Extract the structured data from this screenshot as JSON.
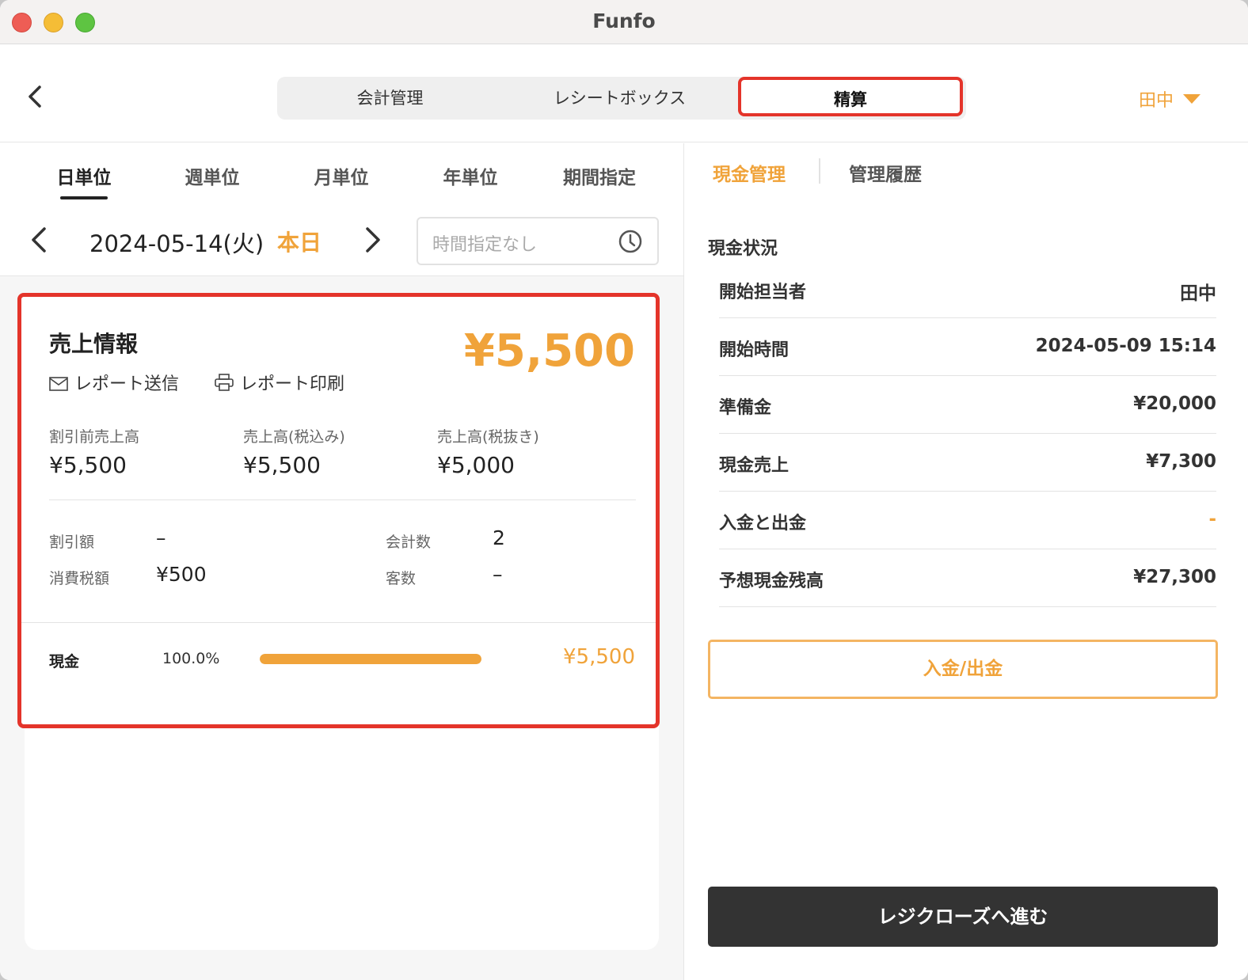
{
  "window": {
    "title": "Funfo"
  },
  "header": {
    "tabs": [
      {
        "label": "会計管理"
      },
      {
        "label": "レシートボックス"
      },
      {
        "label": "精算"
      }
    ],
    "user": "田中"
  },
  "left": {
    "period_tabs": [
      {
        "label": "日単位"
      },
      {
        "label": "週単位"
      },
      {
        "label": "月単位"
      },
      {
        "label": "年単位"
      },
      {
        "label": "期間指定"
      }
    ],
    "date": "2024-05-14(火)",
    "today": "本日",
    "time_placeholder": "時間指定なし",
    "sales": {
      "title": "売上情報",
      "total": "¥5,500",
      "report_send": "レポート送信",
      "report_print": "レポート印刷",
      "stats": [
        {
          "label": "割引前売上高",
          "value": "¥5,500"
        },
        {
          "label": "売上高(税込み)",
          "value": "¥5,500"
        },
        {
          "label": "売上高(税抜き)",
          "value": "¥5,000"
        }
      ],
      "discount_label": "割引額",
      "discount_value": "–",
      "tax_label": "消費税額",
      "tax_value": "¥500",
      "count_label": "会計数",
      "count_value": "2",
      "guests_label": "客数",
      "guests_value": "–",
      "payment": {
        "label": "現金",
        "percent": "100.0%",
        "fraction": 1.0,
        "amount": "¥5,500"
      }
    }
  },
  "right": {
    "tabs": [
      {
        "label": "現金管理"
      },
      {
        "label": "管理履歴"
      }
    ],
    "section_title": "現金状況",
    "rows": [
      {
        "label": "開始担当者",
        "value": "田中"
      },
      {
        "label": "開始時間",
        "value": "2024-05-09 15:14"
      },
      {
        "label": "準備金",
        "value": "¥20,000"
      },
      {
        "label": "現金売上",
        "value": "¥7,300"
      },
      {
        "label": "入金と出金",
        "value": "-"
      },
      {
        "label": "予想現金残高",
        "value": "¥27,300"
      }
    ],
    "deposit_button": "入金/出金",
    "close_button": "レジクローズへ進む"
  },
  "colors": {
    "accent": "#f0a33a",
    "highlight": "#e4342a",
    "dark_button": "#333333"
  }
}
